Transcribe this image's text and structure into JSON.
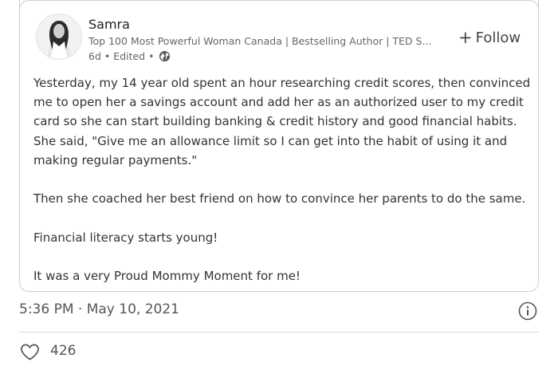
{
  "post": {
    "author_name": "Samra",
    "author_headline": "Top 100 Most Powerful Woman Canada | Bestselling Author | TED S...",
    "meta_age": "6d",
    "meta_edited": "Edited",
    "follow_label": "Follow",
    "paragraphs": [
      "Yesterday, my 14 year old spent an hour researching credit scores, then convinced me to open her a savings account and add her as an authorized user to my credit card so she can start building banking & credit history and good financial habits. She said, \"Give me an allowance limit so I can get into the habit of using it and making regular payments.\"",
      "Then she coached her best friend on how to convince her parents to do the same.",
      "Financial literacy starts young!",
      "It was a very Proud Mommy Moment for me!"
    ]
  },
  "tweet": {
    "timestamp": "5:36 PM · May 10, 2021",
    "like_count": "426"
  },
  "icons": {
    "globe": "globe-icon",
    "info": "info-icon",
    "like": "heart-icon"
  }
}
